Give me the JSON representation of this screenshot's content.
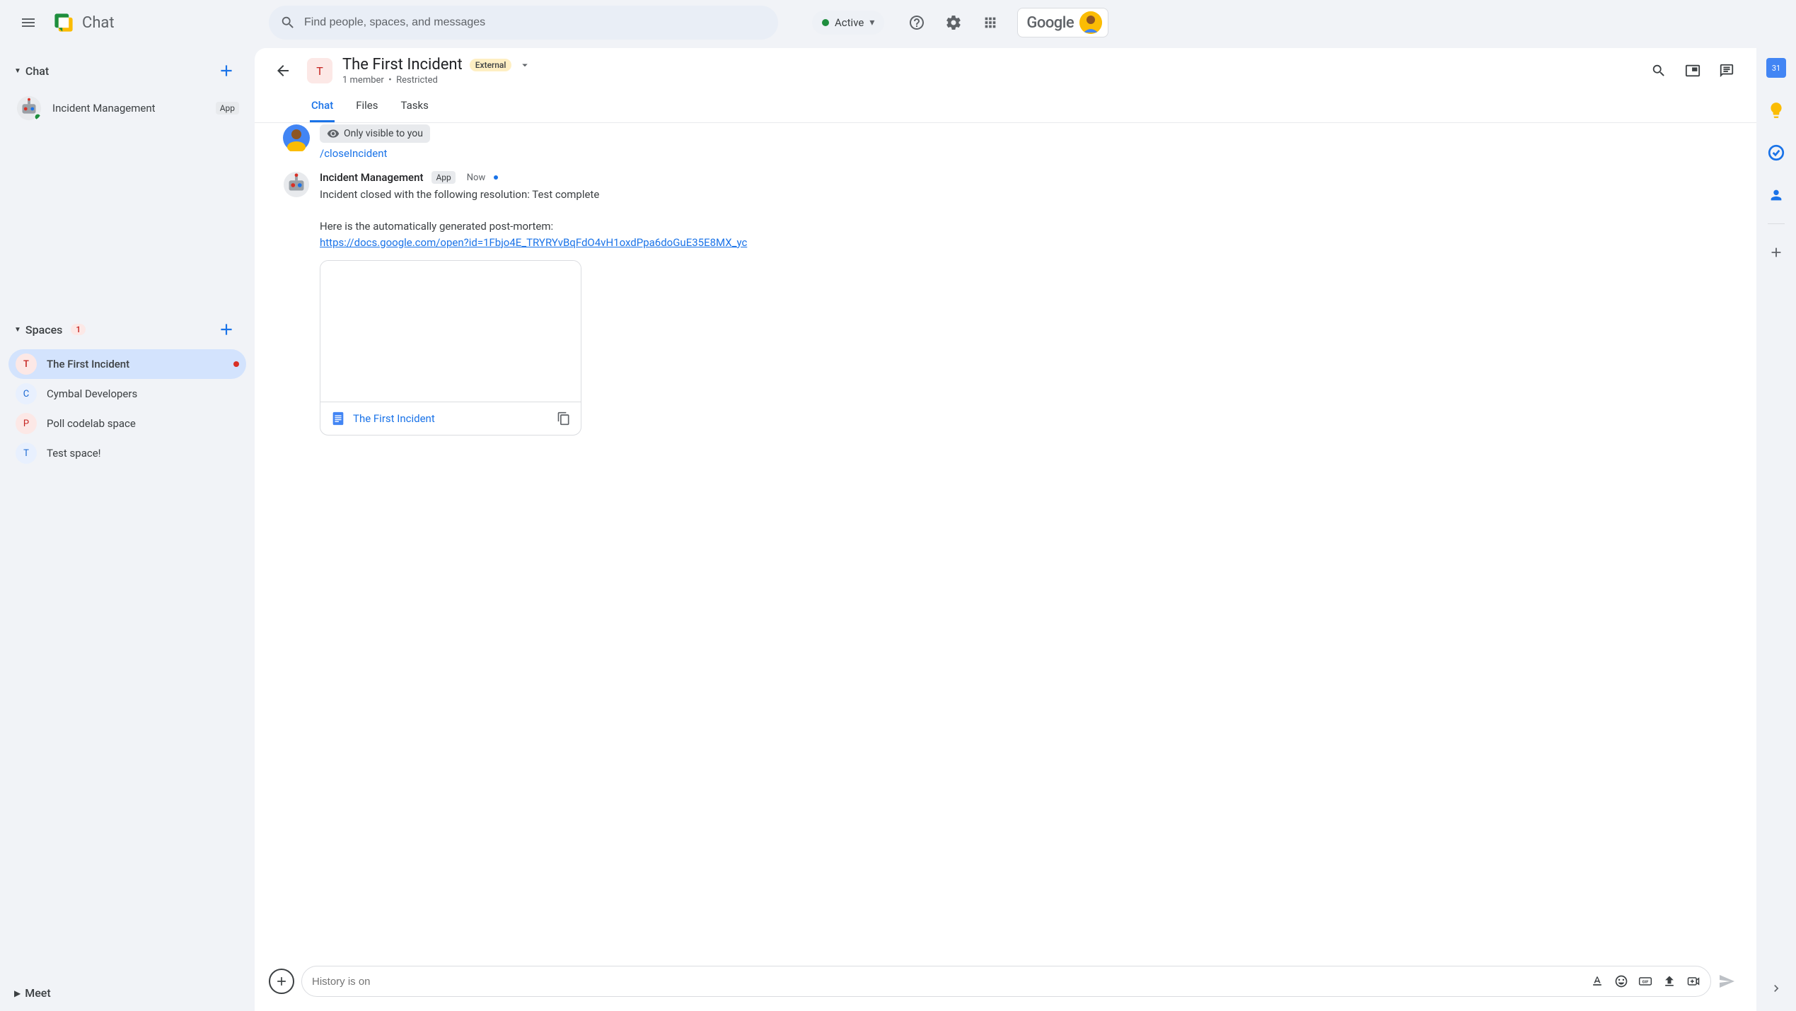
{
  "header": {
    "app_name": "Chat",
    "search_placeholder": "Find people, spaces, and messages",
    "status_label": "Active",
    "google_label": "Google"
  },
  "sidebar": {
    "chat_section": "Chat",
    "chat_items": [
      {
        "label": "Incident Management",
        "badge": "App"
      }
    ],
    "spaces_section": "Spaces",
    "spaces_count": "1",
    "spaces_items": [
      {
        "initial": "T",
        "label": "The First Incident",
        "active": true,
        "dot": true
      },
      {
        "initial": "C",
        "label": "Cymbal Developers"
      },
      {
        "initial": "P",
        "label": "Poll codelab space"
      },
      {
        "initial": "T",
        "label": "Test space!"
      }
    ],
    "meet_section": "Meet"
  },
  "main": {
    "space_initial": "T",
    "space_title": "The First Incident",
    "external_badge": "External",
    "subtitle_members": "1 member",
    "subtitle_sep": "•",
    "subtitle_restricted": "Restricted",
    "tabs": {
      "chat": "Chat",
      "files": "Files",
      "tasks": "Tasks"
    }
  },
  "messages": {
    "visibility_notice": "Only visible to you",
    "command": "/closeIncident",
    "bot_name": "Incident Management",
    "bot_badge": "App",
    "bot_time": "Now",
    "bot_line1": "Incident closed with the following resolution: Test complete",
    "bot_line2": "Here is the automatically generated post-mortem:",
    "bot_link": "https://docs.google.com/open?id=1Fbjo4E_TRYRYvBqFdO4vH1oxdPpa6doGuE35E8MX_yc",
    "attachment_name": "The First Incident"
  },
  "composer": {
    "placeholder": "History is on"
  },
  "rail": {
    "calendar_day": "31"
  }
}
